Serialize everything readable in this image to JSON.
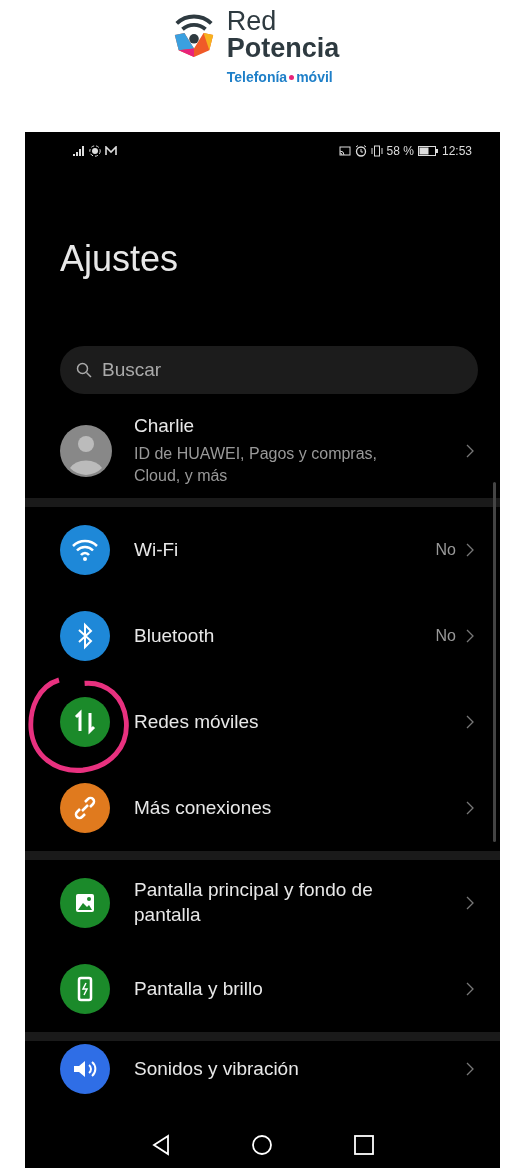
{
  "logo": {
    "line_1": "Red",
    "line_2": "Potencia",
    "tagline_1": "Telefonía",
    "tagline_2": "móvil"
  },
  "status_bar": {
    "battery": "58 %",
    "time": "12:53"
  },
  "title": "Ajustes",
  "search": {
    "placeholder": "Buscar"
  },
  "account": {
    "name": "Charlie",
    "subtitle": "ID de HUAWEI, Pagos y compras, Cloud, y más"
  },
  "groups": [
    [
      {
        "label": "Wi-Fi",
        "value": "No",
        "color": "#1e88d8",
        "circled": false
      },
      {
        "label": "Bluetooth",
        "value": "No",
        "color": "#1e88d8",
        "circled": false
      },
      {
        "label": "Redes móviles",
        "color": "#1b8a2a",
        "circled": true
      },
      {
        "label": "Más conexiones",
        "color": "#e07a1e",
        "circled": false
      }
    ],
    [
      {
        "label": "Pantalla principal y fondo de pantalla",
        "color": "#1b8a2a",
        "circled": false
      },
      {
        "label": "Pantalla y brillo",
        "color": "#1b8a2a",
        "circled": false
      }
    ],
    [
      {
        "label": "Sonidos y vibración",
        "color": "#2f6ee6",
        "circled": false
      }
    ]
  ]
}
